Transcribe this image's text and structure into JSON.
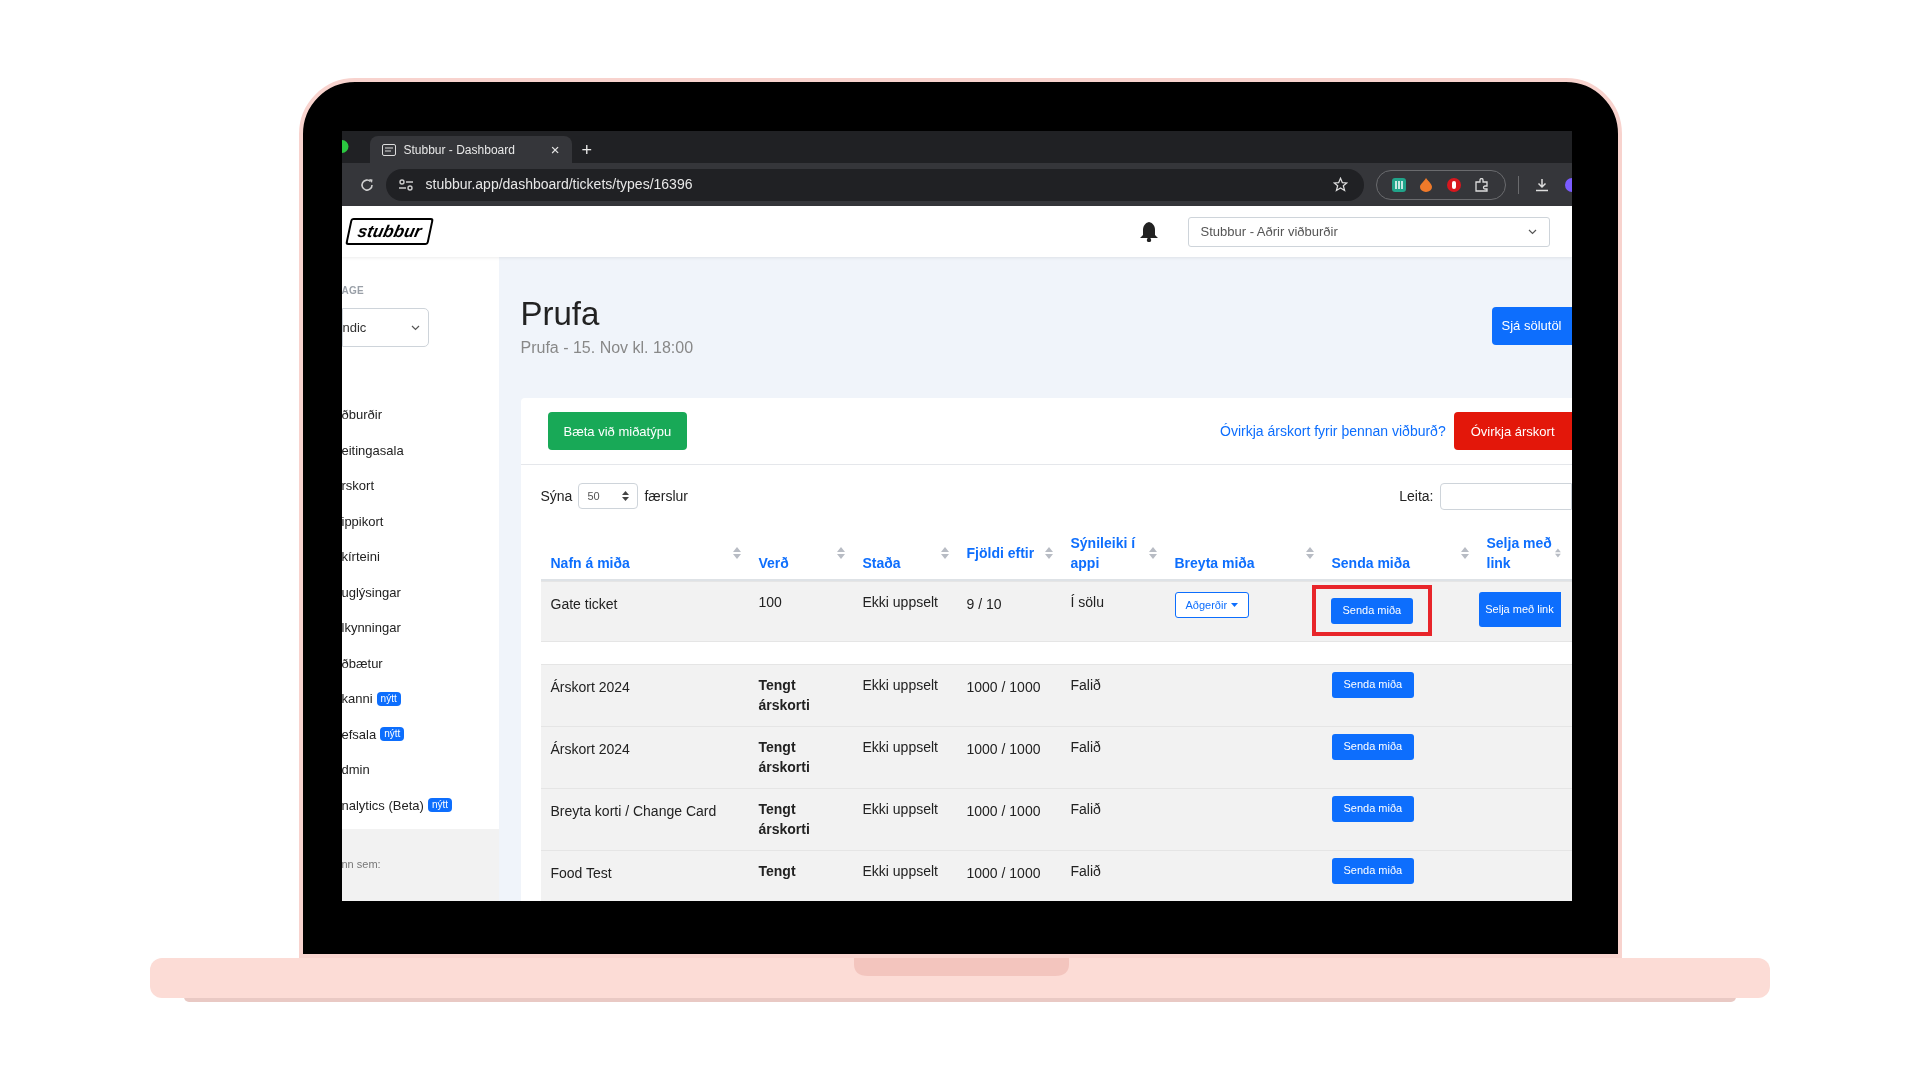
{
  "browser": {
    "tab_title": "Stubbur - Dashboard",
    "tab_close": "×",
    "new_tab": "+",
    "url": "stubbur.app/dashboard/tickets/types/16396"
  },
  "header": {
    "logo": "stubbur",
    "org_select": "Stubbur - Aðrir viðburðir"
  },
  "sidebar": {
    "section_label": "AGE",
    "language_select": "ndic",
    "items": [
      {
        "label": "ðburðir"
      },
      {
        "label": "eitingasala"
      },
      {
        "label": "rskort"
      },
      {
        "label": "ippikort"
      },
      {
        "label": "kírteini"
      },
      {
        "label": "uglýsingar"
      },
      {
        "label": "lkynningar"
      },
      {
        "label": "ðbætur"
      },
      {
        "label": "kanni",
        "badge": "nýtt"
      },
      {
        "label": "efsala",
        "badge": "nýtt"
      },
      {
        "label": "dmin"
      },
      {
        "label": "nalytics (Beta)",
        "badge": "nýtt"
      }
    ],
    "footer": "nn sem:"
  },
  "page": {
    "title": "Prufa",
    "subtitle": "Prufa - 15. Nov kl. 18:00",
    "stats_button": "Sjá sölutöl"
  },
  "toolbar": {
    "add_button": "Bæta við miðatýpu",
    "deactivate_link": "Óvirkja árskort fyrir þennan viðburð?",
    "deactivate_button": "Óvirkja árskort"
  },
  "table_controls": {
    "show_label": "Sýna",
    "page_size": "50",
    "entries_label": "færslur",
    "search_label": "Leita:"
  },
  "table": {
    "columns": [
      "Nafn á miða",
      "Verð",
      "Staða",
      "Fjöldi eftir",
      "Sýnileiki í appi",
      "Breyta miða",
      "Senda miða",
      "Selja með link"
    ],
    "rows": [
      {
        "kind": "ticket",
        "name": "Gate ticket",
        "price": "100",
        "price_bold": false,
        "status": "Ekki uppselt",
        "remaining": "9 / 10",
        "visibility": "Í sölu",
        "action_menu": "Aðgerðir",
        "send_button": "Senda miða",
        "sell_button": "Selja með link",
        "highlighted": true
      },
      {
        "kind": "empty"
      },
      {
        "kind": "ticket",
        "name": "Árskort 2024",
        "price": "Tengt árskorti",
        "price_bold": true,
        "status": "Ekki uppselt",
        "remaining": "1000 / 1000",
        "visibility": "Falið",
        "send_button": "Senda miða",
        "highlighted": false
      },
      {
        "kind": "ticket",
        "name": "Árskort 2024",
        "price": "Tengt árskorti",
        "price_bold": true,
        "status": "Ekki uppselt",
        "remaining": "1000 / 1000",
        "visibility": "Falið",
        "send_button": "Senda miða",
        "highlighted": false
      },
      {
        "kind": "ticket",
        "name": "Breyta korti / Change Card",
        "price": "Tengt árskorti",
        "price_bold": true,
        "status": "Ekki uppselt",
        "remaining": "1000 / 1000",
        "visibility": "Falið",
        "send_button": "Senda miða",
        "highlighted": false
      },
      {
        "kind": "ticket",
        "name": "Food Test",
        "price": "Tengt",
        "price_bold": true,
        "status": "Ekki uppselt",
        "remaining": "1000 / 1000",
        "visibility": "Falið",
        "send_button": "Senda miða",
        "highlighted": false
      }
    ]
  }
}
